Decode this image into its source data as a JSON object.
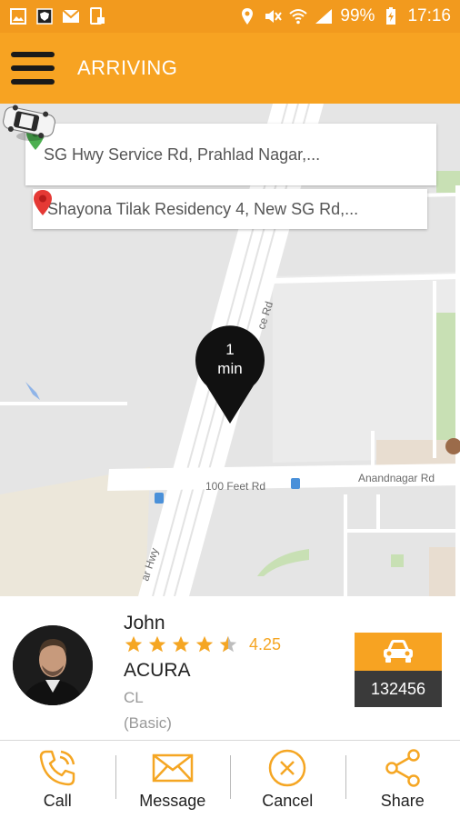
{
  "status_bar": {
    "battery": "99%",
    "time": "17:16",
    "icons": [
      "gallery-icon",
      "shield-app-icon",
      "mail-icon",
      "phone-lock-icon",
      "location-icon",
      "mute-icon",
      "wifi-icon",
      "signal-icon",
      "battery-charging-icon"
    ]
  },
  "app_bar": {
    "title": "ARRIVING",
    "menu_icon": "hamburger-menu-icon"
  },
  "map": {
    "pickup_address": "SG Hwy Service Rd, Prahlad Nagar,...",
    "drop_address": "Shayona Tilak Residency 4, New SG Rd,...",
    "eta_value": "1",
    "eta_unit": "min",
    "road_labels": {
      "hundred_feet": "100 Feet Rd",
      "anandnagar": "Anandnagar Rd",
      "service_rd": "ce Rd",
      "hwy": "ar Hwy"
    },
    "colors": {
      "pickup_pin": "#4caf50",
      "drop_pin": "#e53935"
    }
  },
  "driver": {
    "name": "John",
    "rating_stars": 4.5,
    "rating": "4.25",
    "car_make": "ACURA",
    "car_model": "CL",
    "car_class": "(Basic)",
    "vehicle_number": "132456",
    "vehicle_icon": "car-icon"
  },
  "actions": [
    {
      "label": "Call",
      "icon": "phone-icon"
    },
    {
      "label": "Message",
      "icon": "envelope-icon"
    },
    {
      "label": "Cancel",
      "icon": "cancel-circle-icon"
    },
    {
      "label": "Share",
      "icon": "share-icon"
    }
  ],
  "colors": {
    "accent": "#f7a322",
    "status_bar": "#f29a1e",
    "vehicle_number_bg": "#3a3a3a",
    "star": "#f5a623"
  }
}
